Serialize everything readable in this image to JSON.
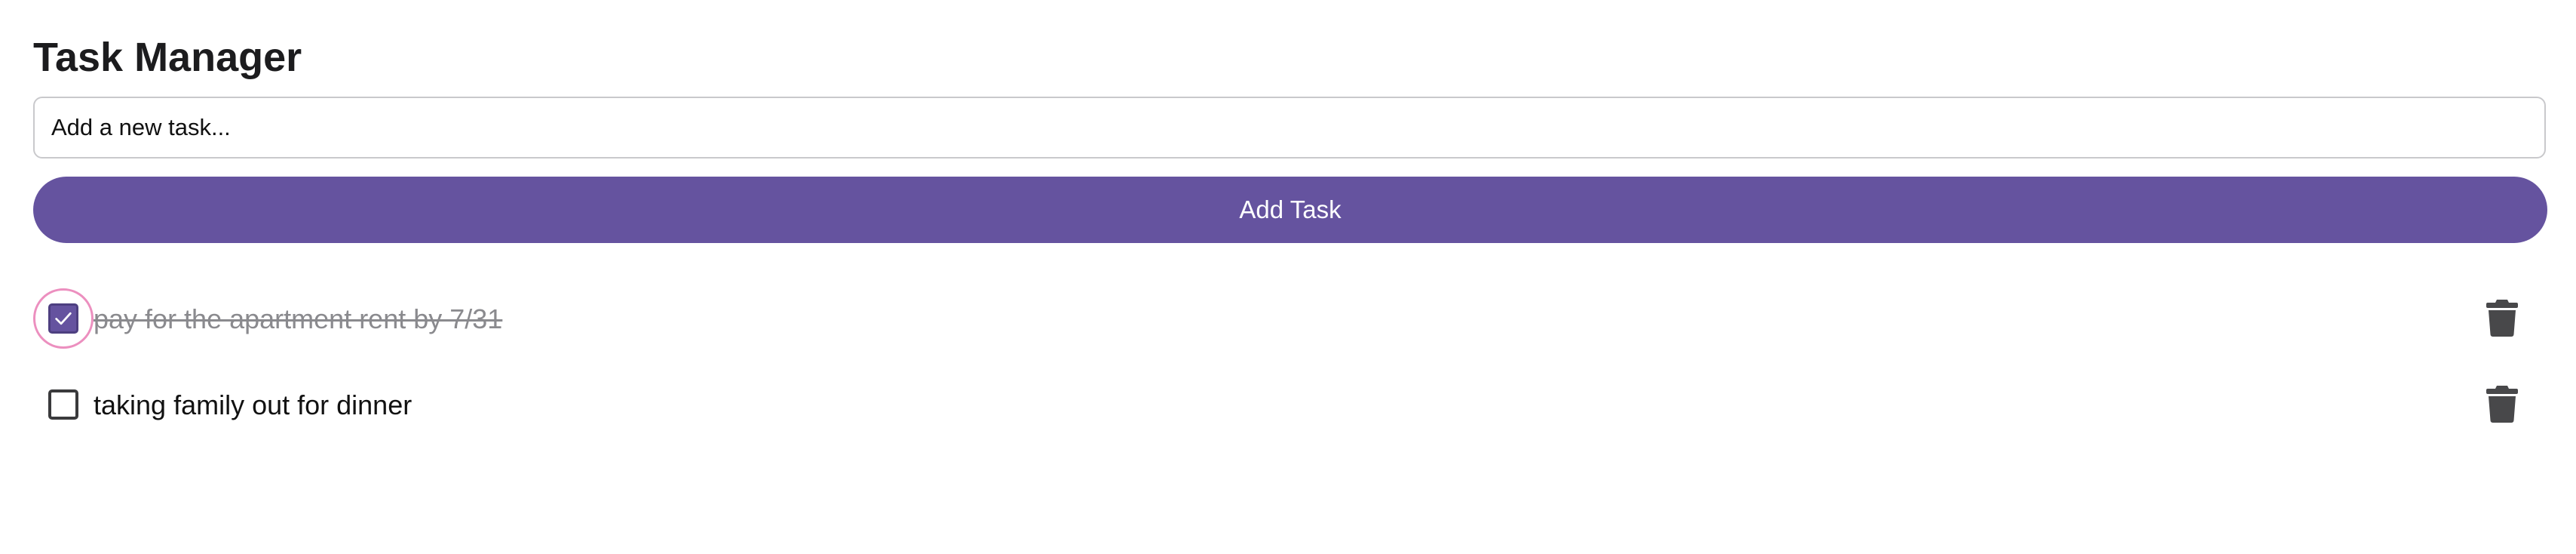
{
  "app": {
    "title": "Task Manager"
  },
  "input": {
    "placeholder": "Add a new task...",
    "value": ""
  },
  "add_button": {
    "label": "Add Task"
  },
  "tasks": [
    {
      "text": "pay for the apartment rent by 7/31",
      "completed": true,
      "focused": true
    },
    {
      "text": "taking family out for dinner",
      "completed": false,
      "focused": false
    }
  ],
  "colors": {
    "accent": "#65539f",
    "focus_ring": "#ec8fbf",
    "completed_text": "#8a8a8e",
    "delete_icon": "#48484a"
  },
  "icons": {
    "checkbox_checked": "checkmark-icon",
    "delete": "trash-icon"
  }
}
